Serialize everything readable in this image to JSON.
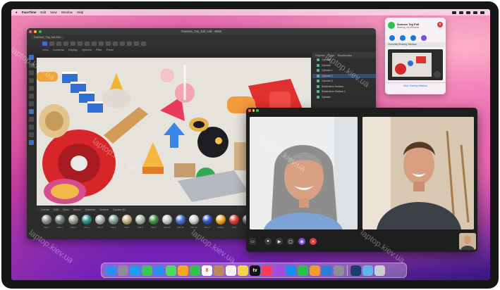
{
  "menubar": {
    "app": "FaceTime",
    "items": [
      "Edit",
      "View",
      "Window",
      "Help"
    ]
  },
  "c4d": {
    "title": "Science_Toy_full_c4d - Main",
    "tab": "Science_Toy_full.c4d",
    "menu": [
      "Create",
      "Edit",
      "View",
      "Select",
      "Material",
      "Texture",
      "Cycles 4D"
    ],
    "objects_header": [
      "Objects",
      "Tags",
      "Bookmarks"
    ],
    "objects": [
      "Cylinder",
      "Cylinder",
      "Cylinder.1",
      "Cylinder.2",
      "Cylinder.3",
      "Subdivision Surface",
      "Subdivision Surface.1",
      "Cylinder"
    ],
    "materials": [
      {
        "label": "Mat.1",
        "color": "#8a8f8f"
      },
      {
        "label": "Mat.2",
        "color": "#6c7b73"
      },
      {
        "label": "Mat.3",
        "color": "#9d9a92"
      },
      {
        "label": "Mat.4",
        "color": "#2f8f8a"
      },
      {
        "label": "Mat.5",
        "color": "#b0b0b0"
      },
      {
        "label": "Mat.6",
        "color": "#7fa08f"
      },
      {
        "label": "Mat.7",
        "color": "#c9b07a"
      },
      {
        "label": "Mat.8",
        "color": "#a5b5a9"
      },
      {
        "label": "Mat.9",
        "color": "#3e8e3a"
      },
      {
        "label": "Mat.10",
        "color": "#c5c5c5"
      },
      {
        "label": "Mat.11",
        "color": "#3f6fd6"
      },
      {
        "label": "Mat.12",
        "color": "#cfcfcf"
      },
      {
        "label": "Blue.2",
        "color": "#2b50c8"
      },
      {
        "label": "Orange",
        "color": "#f5a623"
      },
      {
        "label": "Red",
        "color": "#e23b2e"
      },
      {
        "label": "Grey",
        "color": "#7b7b7b"
      },
      {
        "label": "Wood",
        "color": "#b07c48"
      },
      {
        "label": "Yellow",
        "color": "#f5d64e"
      }
    ]
  },
  "notification": {
    "title": "Science Toy Full",
    "subtitle": "Sharing my Window",
    "section": "Currently Sharing Window",
    "footer": "Stop Sharing Window",
    "close_icon": "close-icon"
  },
  "dock": {
    "apps": [
      {
        "name": "finder-icon",
        "color": "#2f8cf0"
      },
      {
        "name": "launchpad-icon",
        "color": "#8d8d99"
      },
      {
        "name": "safari-icon",
        "color": "#1f9bf0"
      },
      {
        "name": "messages-icon",
        "color": "#34c759"
      },
      {
        "name": "mail-icon",
        "color": "#2b8ef0"
      },
      {
        "name": "maps-icon",
        "color": "#4cd964"
      },
      {
        "name": "photos-icon",
        "color": "#f5a623"
      },
      {
        "name": "facetime-icon",
        "color": "#30c24a"
      },
      {
        "name": "calendar-icon",
        "color": "#ffffff",
        "text": "8"
      },
      {
        "name": "contacts-icon",
        "color": "#b98a5a"
      },
      {
        "name": "reminders-icon",
        "color": "#f2f2f2"
      },
      {
        "name": "notes-icon",
        "color": "#f7d54a"
      },
      {
        "name": "tv-icon",
        "color": "#111111",
        "text": "tv"
      },
      {
        "name": "music-icon",
        "color": "#fa3c5a"
      },
      {
        "name": "podcasts-icon",
        "color": "#a24ce0"
      },
      {
        "name": "appstore-icon",
        "color": "#1a8cf0"
      },
      {
        "name": "numbers-icon",
        "color": "#2fbf4e"
      },
      {
        "name": "pages-icon",
        "color": "#f29b2e"
      },
      {
        "name": "keynote-icon",
        "color": "#2f7bd6"
      },
      {
        "name": "settings-icon",
        "color": "#8e8e93"
      },
      {
        "name": "cinema4d-icon",
        "color": "#1c3d6e"
      },
      {
        "name": "folder-icon",
        "color": "#5fb3f0"
      },
      {
        "name": "trash-icon",
        "color": "#c9ced4"
      }
    ]
  },
  "watermark": "laptop.kiev.ua"
}
